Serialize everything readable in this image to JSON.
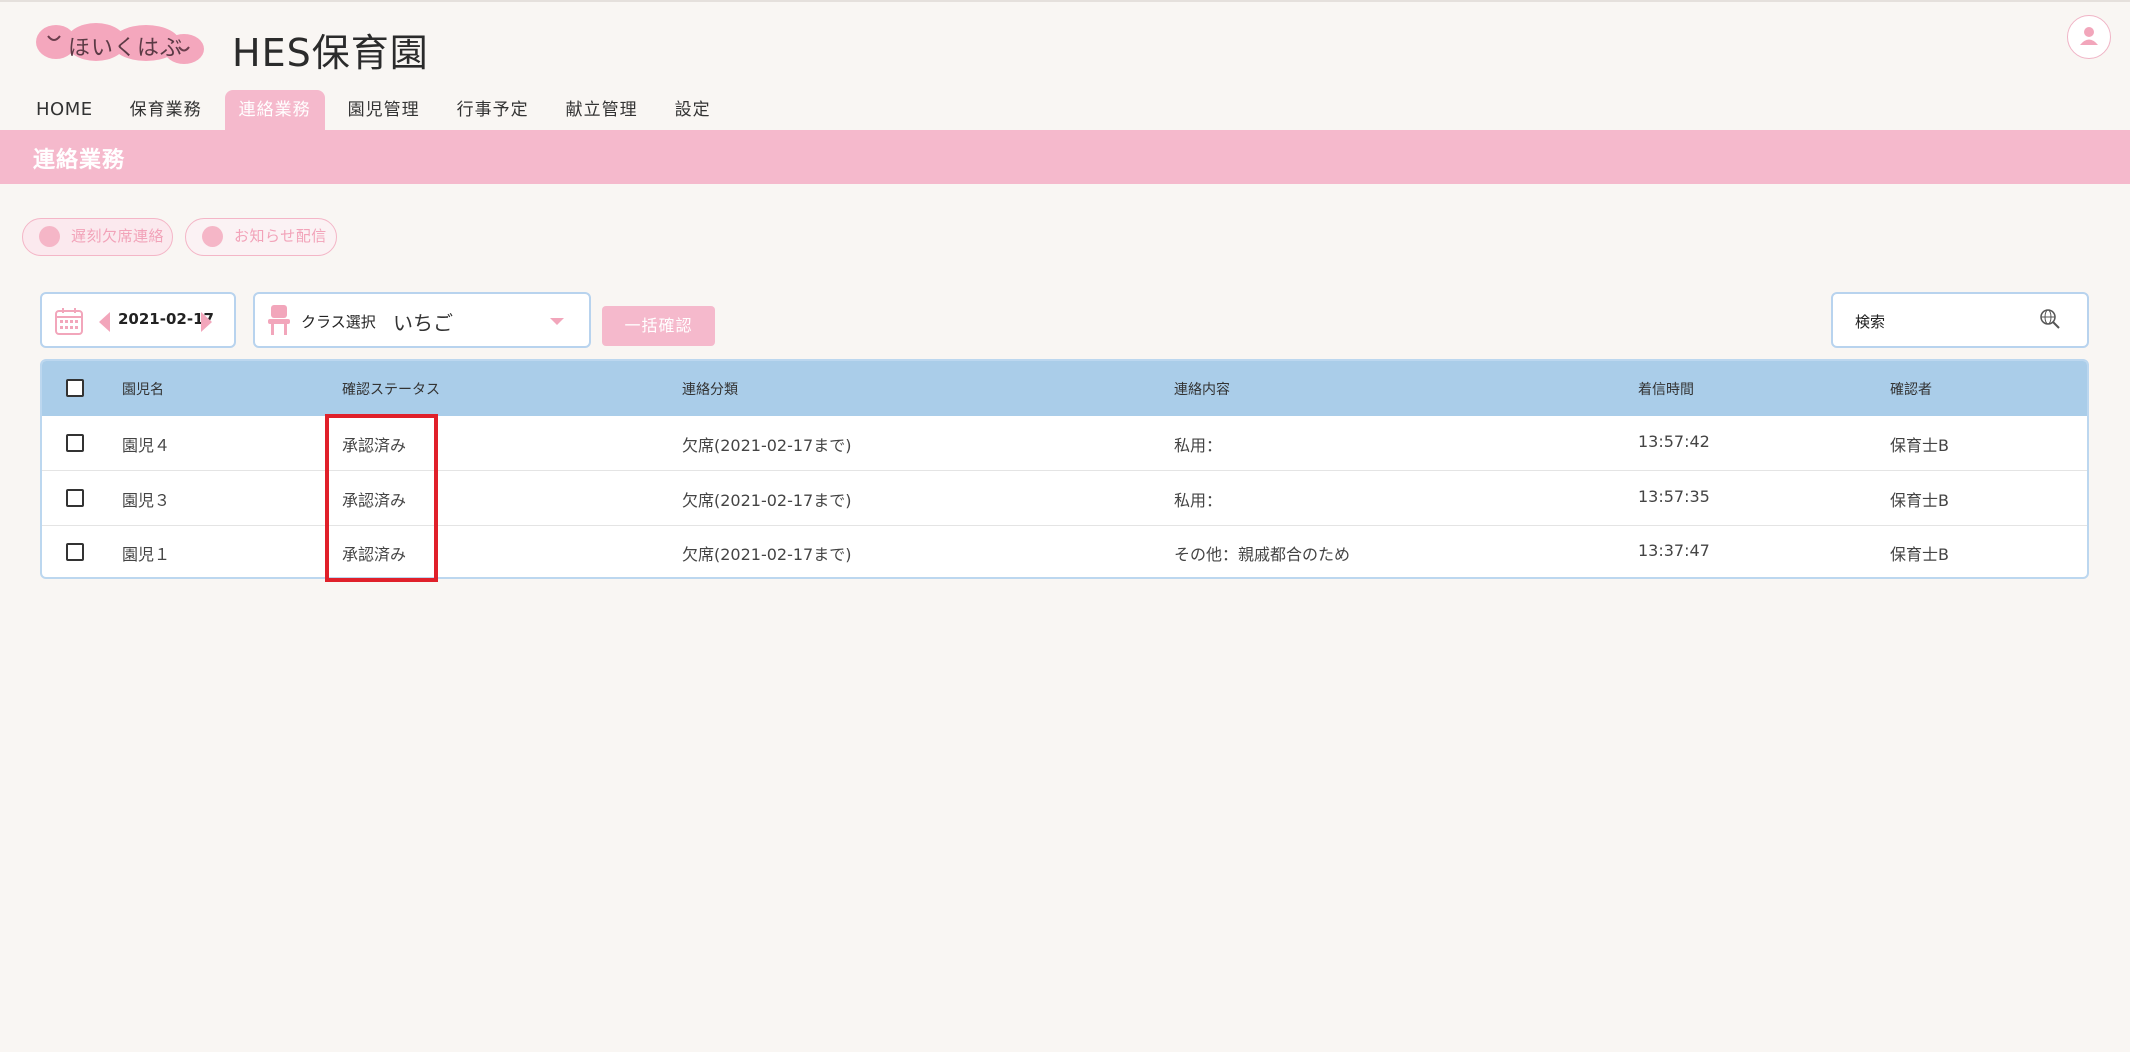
{
  "app": {
    "logo_text": "ほいくはぶ",
    "title": "HES保育園"
  },
  "nav": {
    "items": [
      {
        "label": "HOME"
      },
      {
        "label": "保育業務"
      },
      {
        "label": "連絡業務"
      },
      {
        "label": "園児管理"
      },
      {
        "label": "行事予定"
      },
      {
        "label": "献立管理"
      },
      {
        "label": "設定"
      }
    ],
    "active": "連絡業務"
  },
  "page": {
    "heading": "連絡業務"
  },
  "actions": {
    "late_absence_label": "遅刻欠席連絡",
    "notice_label": "お知らせ配信"
  },
  "filters": {
    "date": "2021-02-17",
    "class_label": "クラス選択",
    "class_value": "いちご",
    "bulk_confirm_label": "一括確認",
    "search_placeholder": "検索"
  },
  "table": {
    "headers": {
      "name": "園児名",
      "status": "確認ステータス",
      "category": "連絡分類",
      "content": "連絡内容",
      "time": "着信時間",
      "confirmer": "確認者"
    },
    "rows": [
      {
        "name": "園児４",
        "status": "承認済み",
        "category": "欠席(2021-02-17まで)",
        "content": "私用：",
        "time": "13:57:42",
        "confirmer": "保育士B"
      },
      {
        "name": "園児３",
        "status": "承認済み",
        "category": "欠席(2021-02-17まで)",
        "content": "私用：",
        "time": "13:57:35",
        "confirmer": "保育士B"
      },
      {
        "name": "園児１",
        "status": "承認済み",
        "category": "欠席(2021-02-17まで)",
        "content": "その他：親戚都合のため",
        "time": "13:37:47",
        "confirmer": "保育士B"
      }
    ]
  },
  "colors": {
    "brand_pink": "#f5b9cc",
    "header_blue": "#aacde9",
    "border_blue": "#b8d3ee",
    "highlight_red": "#e0202a",
    "background": "#f9f6f3"
  },
  "icons": [
    "smile-logo",
    "user-icon",
    "calendar-icon",
    "chair-icon",
    "search-globe-icon",
    "mail-icon",
    "person-bubble-icon"
  ]
}
